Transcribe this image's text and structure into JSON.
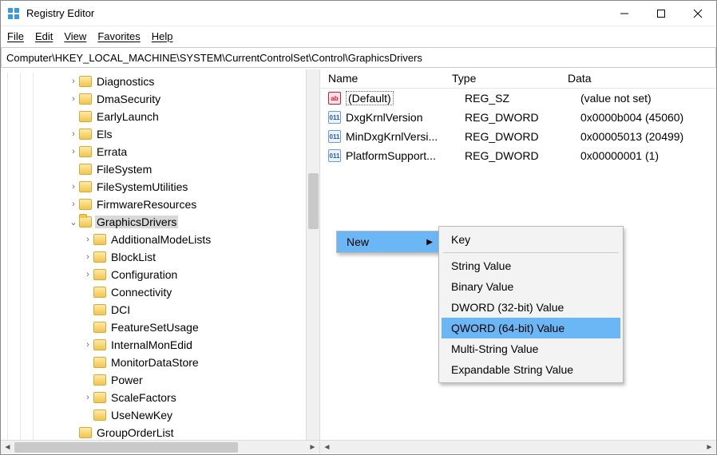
{
  "window": {
    "title": "Registry Editor"
  },
  "menu": {
    "file": "File",
    "edit": "Edit",
    "view": "View",
    "favorites": "Favorites",
    "help": "Help"
  },
  "address": "Computer\\HKEY_LOCAL_MACHINE\\SYSTEM\\CurrentControlSet\\Control\\GraphicsDrivers",
  "tree": [
    {
      "label": "Diagnostics",
      "level": 5,
      "exp": ">"
    },
    {
      "label": "DmaSecurity",
      "level": 5,
      "exp": ">"
    },
    {
      "label": "EarlyLaunch",
      "level": 5,
      "exp": ""
    },
    {
      "label": "Els",
      "level": 5,
      "exp": ">"
    },
    {
      "label": "Errata",
      "level": 5,
      "exp": ">"
    },
    {
      "label": "FileSystem",
      "level": 5,
      "exp": ""
    },
    {
      "label": "FileSystemUtilities",
      "level": 5,
      "exp": ">"
    },
    {
      "label": "FirmwareResources",
      "level": 5,
      "exp": ">"
    },
    {
      "label": "GraphicsDrivers",
      "level": 5,
      "exp": "v",
      "selected": true,
      "open": true
    },
    {
      "label": "AdditionalModeLists",
      "level": 6,
      "exp": ">"
    },
    {
      "label": "BlockList",
      "level": 6,
      "exp": ">"
    },
    {
      "label": "Configuration",
      "level": 6,
      "exp": ">"
    },
    {
      "label": "Connectivity",
      "level": 6,
      "exp": ""
    },
    {
      "label": "DCI",
      "level": 6,
      "exp": ""
    },
    {
      "label": "FeatureSetUsage",
      "level": 6,
      "exp": ""
    },
    {
      "label": "InternalMonEdid",
      "level": 6,
      "exp": ">"
    },
    {
      "label": "MonitorDataStore",
      "level": 6,
      "exp": ""
    },
    {
      "label": "Power",
      "level": 6,
      "exp": ""
    },
    {
      "label": "ScaleFactors",
      "level": 6,
      "exp": ">"
    },
    {
      "label": "UseNewKey",
      "level": 6,
      "exp": ""
    },
    {
      "label": "GroupOrderList",
      "level": 5,
      "exp": ""
    }
  ],
  "list": {
    "cols": {
      "name": "Name",
      "type": "Type",
      "data": "Data"
    },
    "rows": [
      {
        "icon": "str",
        "name": "(Default)",
        "type": "REG_SZ",
        "data": "(value not set)",
        "selected": true
      },
      {
        "icon": "bin",
        "name": "DxgKrnlVersion",
        "type": "REG_DWORD",
        "data": "0x0000b004 (45060)"
      },
      {
        "icon": "bin",
        "name": "MinDxgKrnlVersi...",
        "type": "REG_DWORD",
        "data": "0x00005013 (20499)"
      },
      {
        "icon": "bin",
        "name": "PlatformSupport...",
        "type": "REG_DWORD",
        "data": "0x00000001 (1)"
      }
    ]
  },
  "ctx": {
    "parent": "New",
    "sub": [
      "Key",
      "-",
      "String Value",
      "Binary Value",
      "DWORD (32-bit) Value",
      "QWORD (64-bit) Value",
      "Multi-String Value",
      "Expandable String Value"
    ],
    "highlighted": "QWORD (64-bit) Value"
  }
}
